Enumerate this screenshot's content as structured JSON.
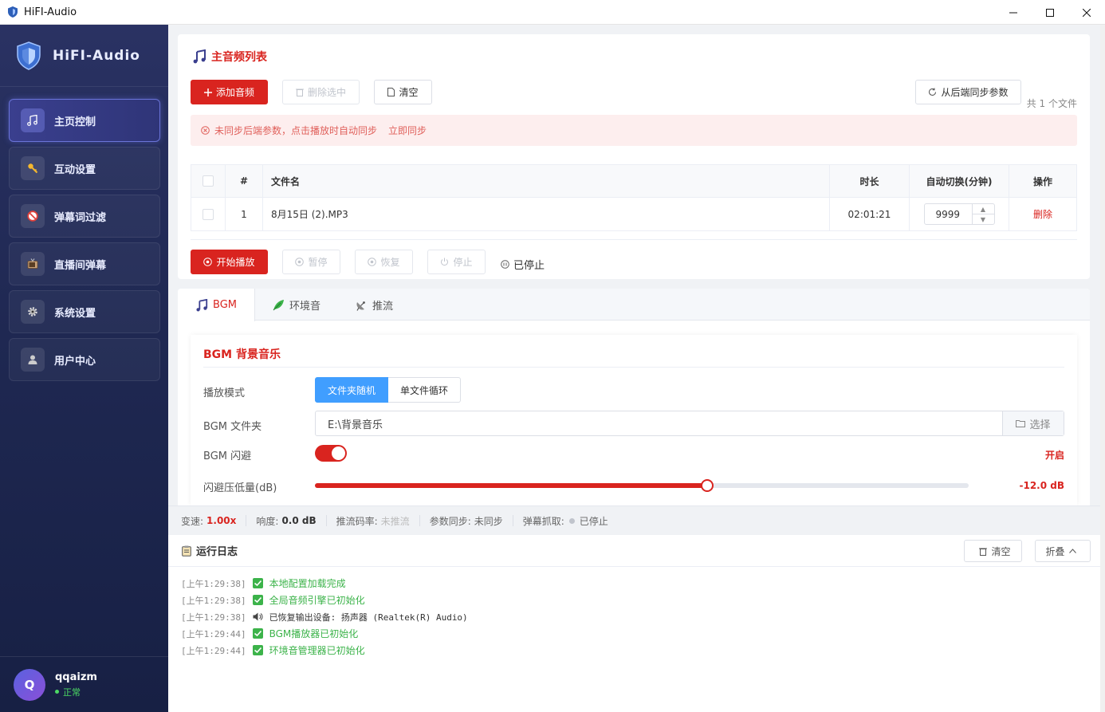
{
  "window": {
    "title": "HiFI-Audio"
  },
  "sidebar": {
    "brand": "HiFI-Audio",
    "items": [
      {
        "label": "主页控制",
        "icon": "music-note-icon",
        "active": true
      },
      {
        "label": "互动设置",
        "icon": "key-icon",
        "active": false
      },
      {
        "label": "弹幕词过滤",
        "icon": "block-icon",
        "active": false
      },
      {
        "label": "直播间弹幕",
        "icon": "tv-icon",
        "active": false
      },
      {
        "label": "系统设置",
        "icon": "gear-icon",
        "active": false
      },
      {
        "label": "用户中心",
        "icon": "user-icon",
        "active": false
      }
    ],
    "user": {
      "initial": "Q",
      "name": "qqaizm",
      "status": "正常"
    }
  },
  "playlist": {
    "title": "主音频列表",
    "buttons": {
      "add": "添加音频",
      "delete_selected": "删除选中",
      "clear": "清空",
      "sync": "从后端同步参数"
    },
    "file_count": "共 1 个文件",
    "alert": {
      "text": "未同步后端参数，点击播放时自动同步",
      "link": "立即同步"
    },
    "columns": [
      "#",
      "文件名",
      "时长",
      "自动切换(分钟)",
      "操作"
    ],
    "rows": [
      {
        "index": "1",
        "name": "8月15日 (2).MP3",
        "duration": "02:01:21",
        "auto_switch": "9999",
        "action": "删除"
      }
    ],
    "controls": {
      "start": "开始播放",
      "pause": "暂停",
      "resume": "恢复",
      "stop": "停止",
      "status": "已停止"
    }
  },
  "tabs": [
    {
      "label": "BGM",
      "active": true
    },
    {
      "label": "环境音",
      "active": false
    },
    {
      "label": "推流",
      "active": false
    }
  ],
  "bgm": {
    "title": "BGM 背景音乐",
    "play_mode_label": "播放模式",
    "mode_options": [
      "文件夹随机",
      "单文件循环"
    ],
    "folder_label": "BGM 文件夹",
    "folder_value": "E:\\背景音乐",
    "choose": "选择",
    "ducking_label": "BGM 闪避",
    "ducking_state": "开启",
    "duck_level_label": "闪避压低量(dB)",
    "duck_level_value": "-12.0 dB",
    "duck_level_fraction": 0.6
  },
  "statusbar": {
    "speed_label": "变速:",
    "speed_value": "1.00x",
    "loudness_label": "响度:",
    "loudness_value": "0.0 dB",
    "bitrate_label": "推流码率:",
    "bitrate_value": "未推流",
    "param_label": "参数同步:",
    "param_value": "未同步",
    "danmaku_label": "弹幕抓取:",
    "danmaku_value": "已停止"
  },
  "log": {
    "title": "运行日志",
    "clear": "清空",
    "collapse": "折叠",
    "lines": [
      {
        "time": "[上午1:29:38]",
        "icon": "check-icon",
        "text": "本地配置加载完成"
      },
      {
        "time": "[上午1:29:38]",
        "icon": "check-icon",
        "text": "全局音频引擎已初始化"
      },
      {
        "time": "[上午1:29:38]",
        "icon": "speaker-icon",
        "text": "已恢复输出设备: 扬声器 (Realtek(R) Audio)"
      },
      {
        "time": "[上午1:29:44]",
        "icon": "check-icon",
        "text": "BGM播放器已初始化"
      },
      {
        "time": "[上午1:29:44]",
        "icon": "check-icon",
        "text": "环境音管理器已初始化"
      }
    ]
  },
  "colors": {
    "accent": "#d9241f",
    "sidebar": "#1f2852",
    "info": "#409eff"
  }
}
